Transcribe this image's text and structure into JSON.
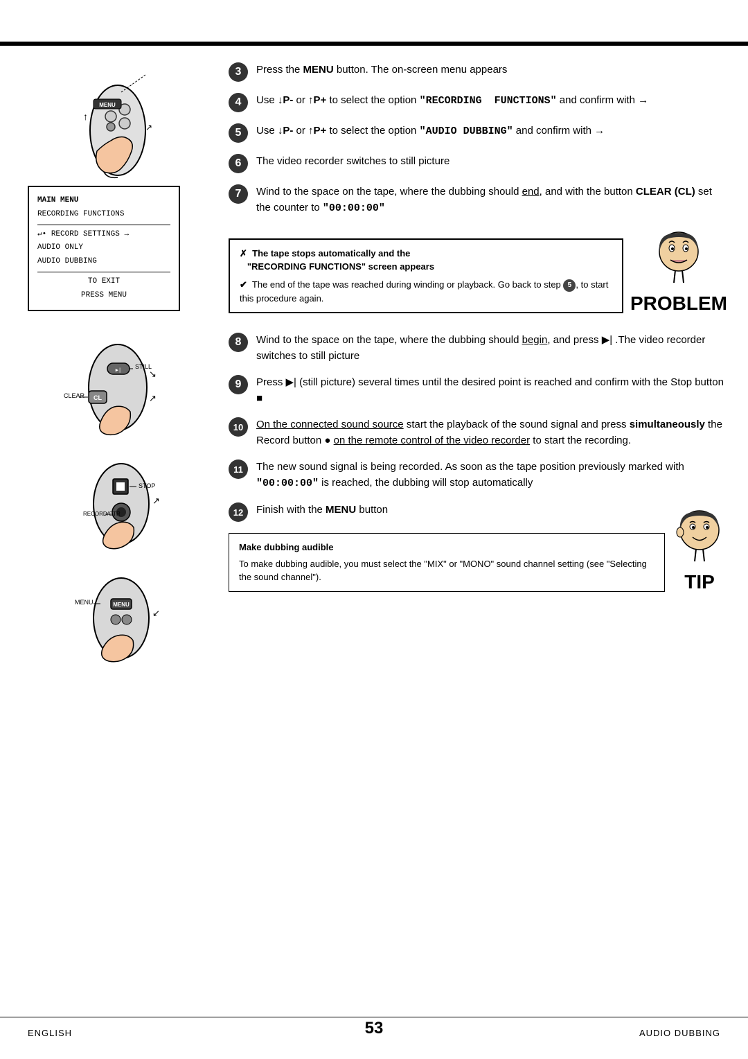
{
  "page": {
    "number": "53",
    "footer_left": "English",
    "footer_right": "Audio Dubbing"
  },
  "steps": [
    {
      "num": "3",
      "text": "Press the <b>MENU</b> button. The on-screen menu appears"
    },
    {
      "num": "4",
      "text": "Use <b>↓P-</b> or <b>↑P+</b> to select the option <span class=\"mono\">\"RECORDING  FUNCTIONS\"</span> and confirm with →"
    },
    {
      "num": "5",
      "text": "Use <b>↓P-</b> or <b>↑P+</b> to select the option <span class=\"mono\">\"AUDIO DUBBING\"</span> and confirm with →"
    },
    {
      "num": "6",
      "text": "The video recorder switches to still picture"
    },
    {
      "num": "7",
      "text": "Wind to the space on the tape, where the dubbing should <u>end</u>, and with the button <b>CLEAR (CL)</b> set the counter to <span class=\"mono\">\"00:00:00\"</span>"
    },
    {
      "num": "8",
      "text": "Wind to the space on the tape, where the dubbing should <u>begin</u>, and press ▶| .The video recorder switches to still picture"
    },
    {
      "num": "9",
      "text": "Press ▶| (still picture) several times until the desired point is reached and confirm with the Stop button ■"
    },
    {
      "num": "10",
      "text": "On the connected sound source start the playback of the sound signal and press <b>simultaneously</b> the Record button ● <u>on the remote control of the video recorder</u> to start the recording."
    },
    {
      "num": "11",
      "text": "The new sound signal is being recorded. As soon as the tape position previously marked with <span class=\"mono\">\"00:00:00\"</span> is reached, the dubbing will stop automatically"
    },
    {
      "num": "12",
      "text": "Finish with the <b>MENU</b> button"
    }
  ],
  "menu_box": {
    "title": "MAIN MENU",
    "subtitle": "RECORDING FUNCTIONS",
    "item1": "↵• RECORD SETTINGS    →",
    "item2": "  AUDIO ONLY",
    "item3": "  AUDIO DUBBING",
    "footer1": "TO EXIT",
    "footer2": "PRESS MENU"
  },
  "note_box": {
    "line1_icon": "✗",
    "line1": "The tape stops automatically and the",
    "line1b": "\"RECORDING FUNCTIONS\" screen appears",
    "line2_icon": "✔",
    "line2": "The end of the tape was reached during winding or playback. Go back to step 5, to start this procedure again."
  },
  "problem_label": "PROBLEM",
  "tip_box": {
    "title": "Make dubbing audible",
    "text": "To make dubbing audible, you must select the \"MIX\" or \"MONO\" sound channel setting (see \"Selecting the sound channel\")."
  },
  "tip_label": "TIP",
  "labels": {
    "menu": "MENU",
    "still": "STILL",
    "clear": "CLEAR",
    "cl": "CL",
    "stop": "STOP",
    "record_otr": "RECORD/OTR"
  }
}
